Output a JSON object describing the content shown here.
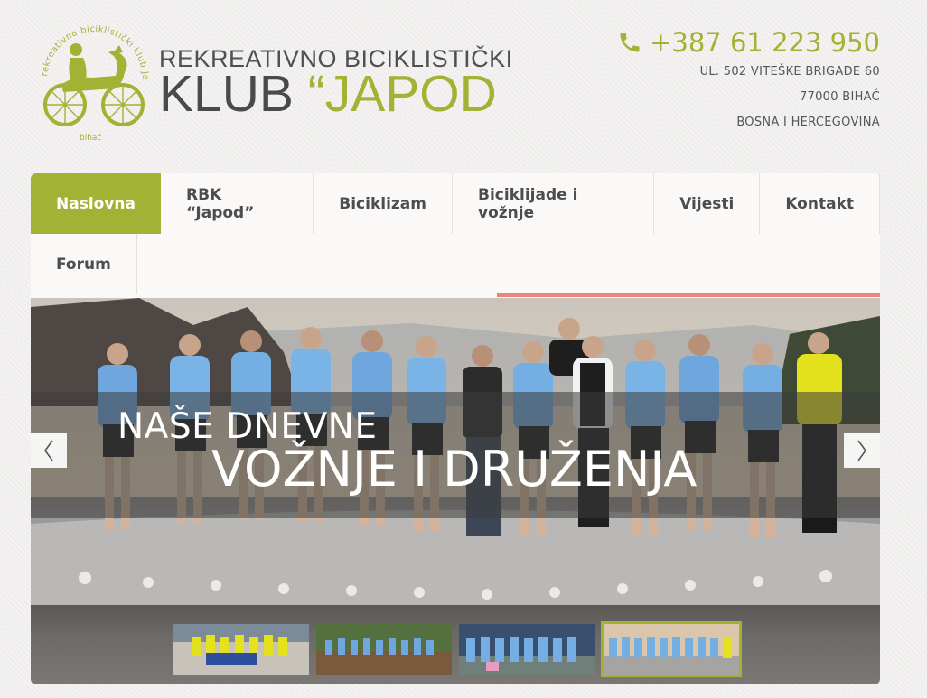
{
  "logo": {
    "circle_text": "rekreativno biciklistički klub Japod",
    "bottom_text": "bihać",
    "line1": "REKREATIVNO BICIKLISTIČKI",
    "line2_main": "KLUB ",
    "line2_accent": "“JAPOD"
  },
  "contact": {
    "phone": "+387 61 223 950",
    "address_line1": "UL. 502 VITEŠKE BRIGADE 60",
    "address_line2": "77000 BIHAĆ",
    "address_line3": "BOSNA I HERCEGOVINA"
  },
  "nav": {
    "items": [
      {
        "label": "Naslovna",
        "active": true
      },
      {
        "label": "RBK “Japod”"
      },
      {
        "label": "Biciklizam"
      },
      {
        "label": "Biciklijade i vožnje"
      },
      {
        "label": "Vijesti"
      },
      {
        "label": "Kontakt"
      },
      {
        "label": "Forum"
      }
    ]
  },
  "slider": {
    "caption_line1": "NAŠE DNEVNE",
    "caption_line2": "VOŽNJE I DRUŽENJA",
    "prev_glyph": "〈",
    "next_glyph": "〉"
  },
  "colors": {
    "accent": "#a2b234",
    "nav_underline": "#e8867b",
    "text_dark": "#4d4d4d"
  }
}
